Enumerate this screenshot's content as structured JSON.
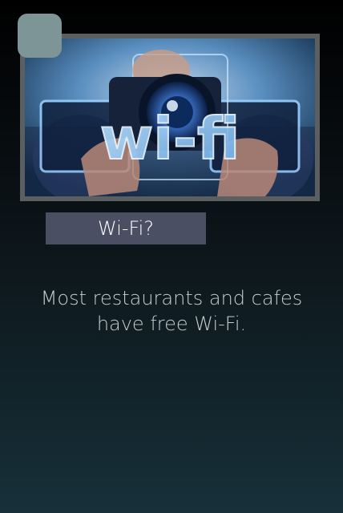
{
  "header": {
    "back_icon": "back-button-icon"
  },
  "hero": {
    "image_icon": "camera-wifi-photo",
    "overlay_text": "wi-fi"
  },
  "card": {
    "title": "Wi-Fi?",
    "body_line_1": "Most restaurants and cafes",
    "body_line_2": "have free Wi-Fi."
  },
  "colors": {
    "background_top": "#000000",
    "background_bottom": "#17303a",
    "back_button": "#7e9597",
    "title_bar": "#4a4f63",
    "body_text": "#c7ccce"
  }
}
